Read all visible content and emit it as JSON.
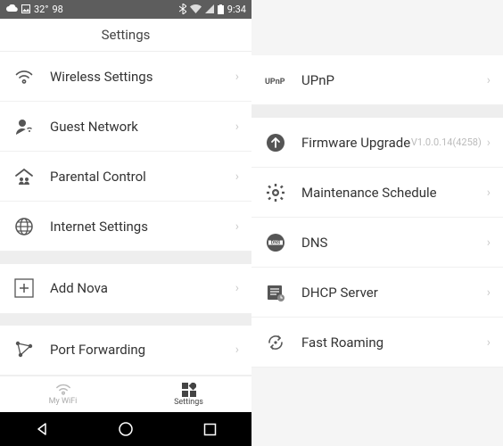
{
  "status": {
    "temp": "32°",
    "count": "98",
    "time": "9:34"
  },
  "header": {
    "title": "Settings"
  },
  "left_rows": [
    {
      "label": "Wireless Settings",
      "icon": "wifi"
    },
    {
      "label": "Guest Network",
      "icon": "guest"
    },
    {
      "label": "Parental Control",
      "icon": "parental"
    },
    {
      "label": "Internet Settings",
      "icon": "globe"
    }
  ],
  "left_rows2": [
    {
      "label": "Add Nova",
      "icon": "plus"
    }
  ],
  "left_rows3": [
    {
      "label": "Port Forwarding",
      "icon": "portfwd"
    }
  ],
  "right_rows1": [
    {
      "label": "UPnP",
      "icon": "upnp"
    }
  ],
  "right_rows2": [
    {
      "label": "Firmware Upgrade",
      "icon": "upgrade",
      "trail": "V1.0.0.14(4258)"
    },
    {
      "label": "Maintenance Schedule",
      "icon": "gear"
    },
    {
      "label": "DNS",
      "icon": "dns"
    },
    {
      "label": "DHCP Server",
      "icon": "dhcp"
    },
    {
      "label": "Fast Roaming",
      "icon": "roaming"
    }
  ],
  "tabs": {
    "mywifi": "My WiFi",
    "settings": "Settings"
  }
}
